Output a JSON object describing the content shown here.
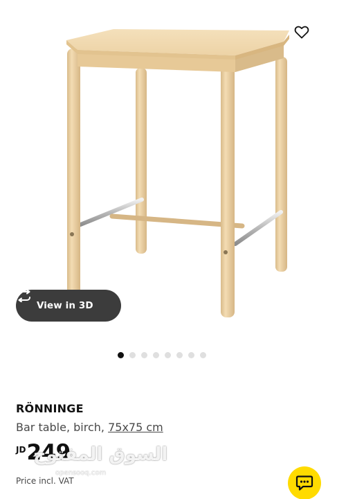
{
  "product": {
    "name": "RÖNNINGE",
    "description": "Bar table, birch, ",
    "size_link": "75x75 cm",
    "price_currency": "JD",
    "price_value": "249",
    "price_note": "Price incl. VAT"
  },
  "actions": {
    "view_3d_label": "View in 3D",
    "favorite_icon": "heart-outline-icon",
    "chat_icon": "chat-bubble-icon"
  },
  "carousel": {
    "total_images": 8,
    "active_index": 0
  },
  "watermark": {
    "arabic_text": "السوق المفتوح",
    "latin_text": "opensooq.com"
  },
  "colors": {
    "accent_yellow": "#ffdb00",
    "pill_background": "#3c3c3c",
    "text_primary": "#111111",
    "text_secondary": "#484848",
    "birch_wood": "#ecd2a6"
  }
}
